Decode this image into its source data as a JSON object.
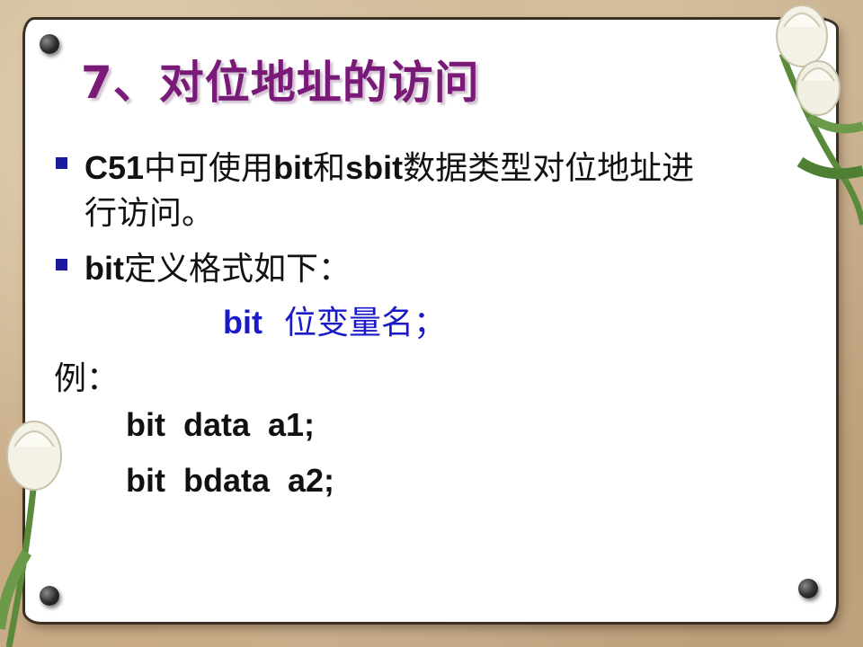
{
  "slide": {
    "title": "7、对位地址的访问",
    "bullet1": {
      "line1_a": "C51",
      "line1_b": "中可使用",
      "line1_c": "bit",
      "line1_d": "和",
      "line1_e": "sbit",
      "line1_f": "数据类型对位地址进",
      "line2": "行访问。"
    },
    "bullet2": {
      "a": "bit",
      "b": "定义格式如下："
    },
    "format": {
      "keyword": "bit",
      "rest": "位变量名；"
    },
    "example_label": "例：",
    "code": [
      "bit  data  a1;",
      "bit  bdata  a2;"
    ]
  }
}
